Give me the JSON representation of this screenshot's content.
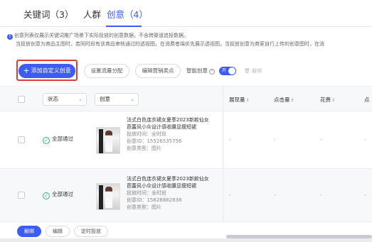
{
  "tabs": [
    {
      "label": "关键词（3）",
      "active": false
    },
    {
      "label": "人群",
      "active": false
    },
    {
      "label": "创意（4）",
      "active": true
    }
  ],
  "notice": {
    "line1": "创意列表仅展示关键词推广场景下实际投放的创意数据，不含跨渠道追投数据。",
    "line2": "当投放创意为商品主图时，若同时段有该商品审核通过的透视图，在消费者端优先展示透视图，当投放创意为商家自行上传的创意图时，在消"
  },
  "toolbar": {
    "add_label": "添加自定义创意",
    "traffic_label": "设置流量分配",
    "edit_label": "编辑营销卖点",
    "smart_label": "智能创意",
    "toggle_label": "开",
    "delete_label": "解绑"
  },
  "table": {
    "status_filter": "状态",
    "creative_filter": "创意",
    "columns": [
      "展现量",
      "点击量",
      "花费",
      "点"
    ],
    "rows": [
      {
        "status": "全部通过",
        "title_line1": "法式白色连衣裙女夏季2023新款仙女",
        "title_line2": "芭蕾风小众设计感收腰显瘦短裙",
        "time": "投放时间：全时段",
        "id": "创意ID：15526535756",
        "type": "创意类型：图片",
        "metrics": [
          "-",
          "-",
          "-",
          "-"
        ]
      },
      {
        "status": "全部通过",
        "title_line1": "法式白色连衣裙女夏季2023新款仙女",
        "title_line2": "芭蕾风小众设计感收腰显瘦短裙",
        "time": "投放时间：全时段",
        "id": "创意ID：15628882838",
        "type": "创意类型：图片",
        "metrics": [
          "-",
          "-",
          "-",
          "-"
        ]
      }
    ]
  },
  "footer": {
    "unbind_label": "解绑",
    "edit_label": "编辑",
    "schedule_label": "定时投放"
  },
  "colors": {
    "accent": "#3d5bf5",
    "success": "#2fb36b",
    "highlight": "#e53935"
  }
}
